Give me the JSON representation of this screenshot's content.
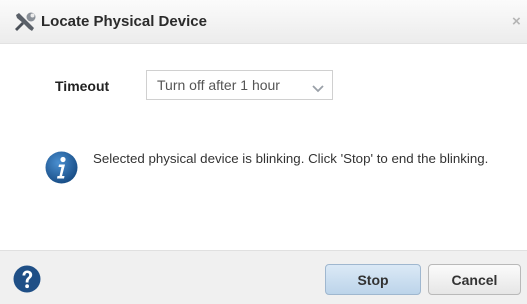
{
  "dialog": {
    "title": "Locate Physical Device",
    "title_icon": "wrench-icon",
    "close_glyph": "×"
  },
  "timeout": {
    "label": "Timeout",
    "selected": "Turn off after 1 hour"
  },
  "message": {
    "icon": "info-icon",
    "text": "Selected physical device is blinking. Click 'Stop' to end the blinking."
  },
  "footer": {
    "help_icon": "help-icon",
    "stop_label": "Stop",
    "cancel_label": "Cancel"
  },
  "colors": {
    "primary_button": "#c9ddf0",
    "icon_blue": "#1f5b99"
  }
}
